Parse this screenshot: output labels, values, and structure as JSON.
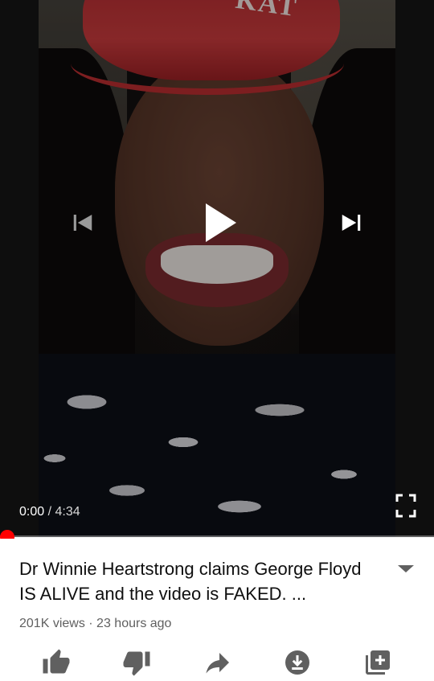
{
  "player": {
    "current_time": "0:00",
    "separator": " / ",
    "duration": "4:34",
    "progress_fraction": 0.0,
    "cap_text": "KAT",
    "accent_color": "#ff0000"
  },
  "video": {
    "title": "Dr Winnie Heartstrong claims George Floyd IS ALIVE and the video is FAKED. ...",
    "views": "201K views",
    "meta_separator": " · ",
    "uploaded": "23 hours ago"
  },
  "icons": {
    "prev": "skip-previous-icon",
    "play": "play-icon",
    "next": "skip-next-icon",
    "fullscreen": "fullscreen-icon",
    "expand": "chevron-down-icon",
    "like": "thumb-up-icon",
    "dislike": "thumb-down-icon",
    "share": "share-icon",
    "download": "download-icon",
    "save": "playlist-add-icon"
  }
}
